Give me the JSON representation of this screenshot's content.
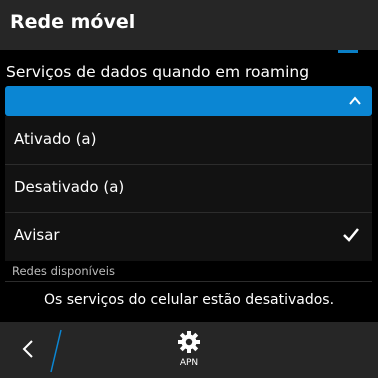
{
  "header": {
    "title": "Rede móvel"
  },
  "roaming": {
    "label": "Serviços de dados quando em roaming",
    "options": [
      {
        "label": "Ativado (a)",
        "selected": false
      },
      {
        "label": "Desativado (a)",
        "selected": false
      },
      {
        "label": "Avisar",
        "selected": true
      }
    ]
  },
  "networks": {
    "label": "Redes disponíveis"
  },
  "status": {
    "text": "Os serviços do celular estão desativados."
  },
  "bottombar": {
    "apn_label": "APN"
  },
  "colors": {
    "accent": "#0b86d3",
    "bar": "#262626",
    "background": "#000000"
  },
  "icons": {
    "back": "back-chevron-icon",
    "apn": "gear-icon",
    "selected": "checkmark-icon",
    "dropdown": "chevron-up-icon"
  }
}
